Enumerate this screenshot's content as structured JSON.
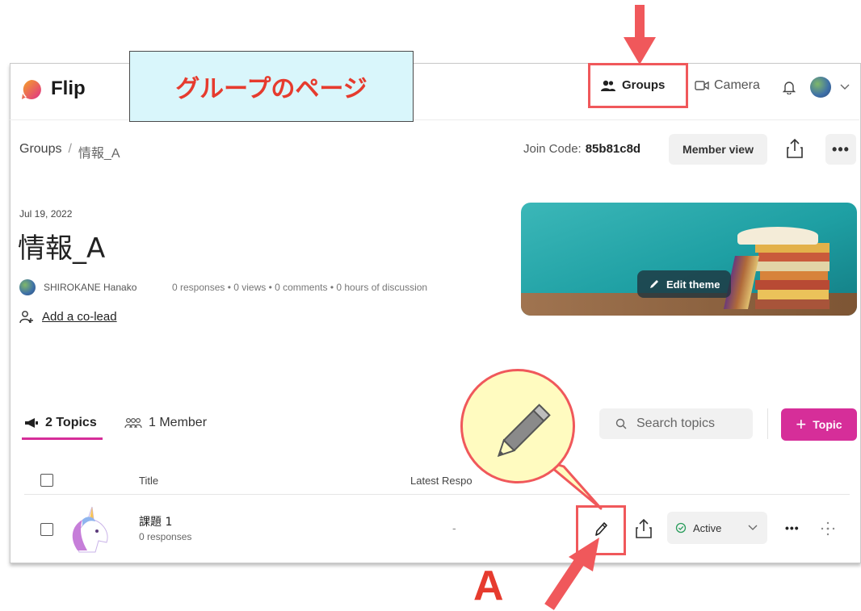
{
  "annotation": {
    "callout_label": "グループのページ",
    "marker_letter": "A",
    "callout_bg": "#d9f6fb",
    "accent_red": "#f0585b"
  },
  "topbar": {
    "logo_text": "Flip",
    "nav": {
      "groups_label": "Groups",
      "camera_label": "Camera"
    },
    "icons": [
      "logo-icon",
      "groups-icon",
      "camera-icon",
      "bell-icon",
      "avatar",
      "chevron-down-icon"
    ]
  },
  "subheader": {
    "breadcrumb_root": "Groups",
    "breadcrumb_sep": "/",
    "breadcrumb_current": "情報_A",
    "join_code_label": "Join Code:",
    "join_code_value": "85b81c8d",
    "member_view_label": "Member view"
  },
  "group": {
    "date": "Jul 19, 2022",
    "title": "情報_A",
    "owner": "SHIROKANE Hanako",
    "stats": "0 responses • 0 views • 0 comments • 0 hours of discussion",
    "add_colead": "Add a co-lead",
    "edit_theme_label": "Edit theme"
  },
  "tabs": {
    "topics_label": "2 Topics",
    "members_label": "1 Member"
  },
  "search": {
    "placeholder": "Search topics"
  },
  "topic_button": {
    "label": "Topic"
  },
  "table": {
    "headers": {
      "title": "Title",
      "latest": "Latest Respo"
    },
    "rows": [
      {
        "title": "課題 1",
        "responses": "0 responses",
        "latest": "-",
        "status": "Active"
      }
    ]
  },
  "colors": {
    "brand_pink": "#d62e99",
    "theme_teal": "#1e9fa3",
    "active_green": "#2a9d5c"
  }
}
